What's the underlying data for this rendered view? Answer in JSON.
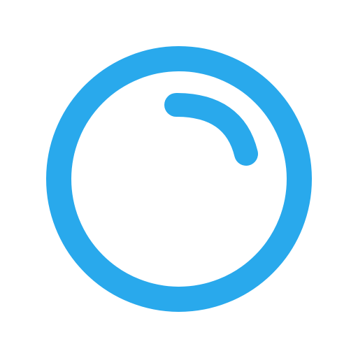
{
  "icon": {
    "name": "bubble-icon",
    "color": "#29A9EC",
    "background": "#FFFFFF"
  }
}
